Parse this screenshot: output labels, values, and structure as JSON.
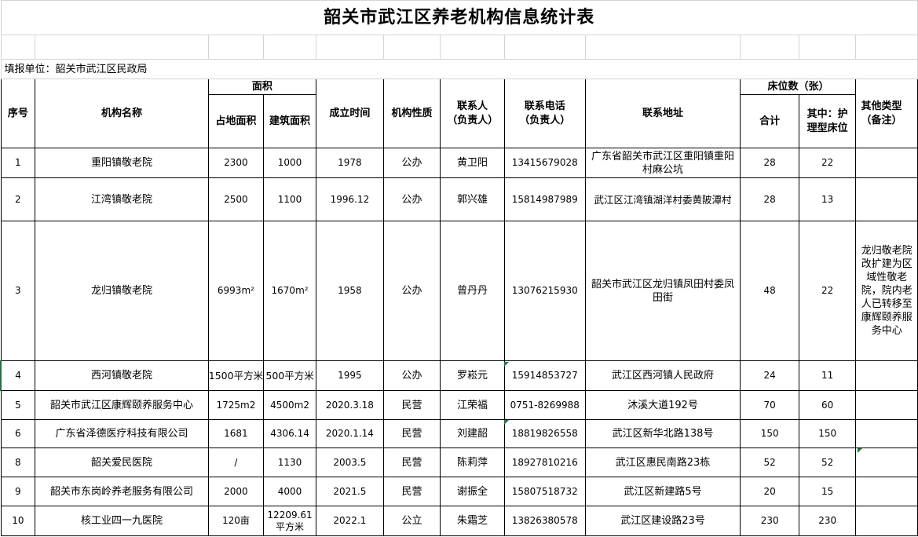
{
  "title": "韶关市武江区养老机构信息统计表",
  "reporting_unit": "填报单位：韶关市武江区民政局",
  "headers": {
    "seq": "序号",
    "name": "机构名称",
    "area_group": "面积",
    "land_area": "占地面积",
    "building_area": "建筑面积",
    "founded": "成立时间",
    "nature": "机构性质",
    "contact": "联系人（负责人）",
    "phone": "联系电话（负责人）",
    "address": "联系地址",
    "beds_group": "床位数（张）",
    "beds_total": "合计",
    "beds_nursing": "其中：护理型床位",
    "other": "其他类型（备注）"
  },
  "rows": [
    {
      "seq": "1",
      "name": "重阳镇敬老院",
      "land": "2300",
      "building": "1000",
      "founded": "1978",
      "nature": "公办",
      "contact": "黄卫阳",
      "phone": "13415679028",
      "address": "广东省韶关市武江区重阳镇重阳村麻公坑",
      "beds": "28",
      "nursing": "22",
      "note": ""
    },
    {
      "seq": "2",
      "name": "江湾镇敬老院",
      "land": "2500",
      "building": "1100",
      "founded": "1996.12",
      "nature": "公办",
      "contact": "郭兴雄",
      "phone": "15814987989",
      "address": "武江区江湾镇湖洋村委黄陂潭村",
      "beds": "28",
      "nursing": "13",
      "note": ""
    },
    {
      "seq": "3",
      "name": "龙归镇敬老院",
      "land": "6993m²",
      "building": "1670m²",
      "founded": "1958",
      "nature": "公办",
      "contact": "曾丹丹",
      "phone": "13076215930",
      "address": "韶关市武江区龙归镇凤田村委凤田街",
      "beds": "48",
      "nursing": "22",
      "note": "龙归敬老院改扩建为区域性敬老院，院内老人已转移至康辉颐养服务中心"
    },
    {
      "seq": "4",
      "name": "西河镇敬老院",
      "land": "1500平方米",
      "building": "500平方米",
      "founded": "1995",
      "nature": "公办",
      "contact": "罗崧元",
      "phone": "15914853727",
      "address": "武江区西河镇人民政府",
      "beds": "24",
      "nursing": "11",
      "note": ""
    },
    {
      "seq": "5",
      "name": "韶关市武江区康辉颐养服务中心",
      "land": "1725m2",
      "building": "4500m2",
      "founded": "2020.3.18",
      "nature": "民营",
      "contact": "江荣福",
      "phone": "0751-8269988",
      "address": "沐溪大道192号",
      "beds": "70",
      "nursing": "60",
      "note": ""
    },
    {
      "seq": "6",
      "name": "广东省泽德医疗科技有限公司",
      "land": "1681",
      "building": "4306.14",
      "founded": "2020.1.14",
      "nature": "民营",
      "contact": "刘建韶",
      "phone": "18819826558",
      "address": "武江区新华北路138号",
      "beds": "150",
      "nursing": "150",
      "note": ""
    },
    {
      "seq": "8",
      "name": "韶关爱民医院",
      "land": "/",
      "building": "1130",
      "founded": "2003.5",
      "nature": "民营",
      "contact": "陈莉萍",
      "phone": "18927810216",
      "address": "武江区惠民南路23栋",
      "beds": "52",
      "nursing": "52",
      "note": ""
    },
    {
      "seq": "9",
      "name": "韶关市东岗岭养老服务有限公司",
      "land": "2000",
      "building": "4000",
      "founded": "2021.5",
      "nature": "民营",
      "contact": "谢振全",
      "phone": "15807518732",
      "address": "武江区新建路5号",
      "beds": "20",
      "nursing": "15",
      "note": ""
    },
    {
      "seq": "10",
      "name": "核工业四一九医院",
      "land": "120亩",
      "building": "12209.61平方米",
      "founded": "2022.1",
      "nature": "公立",
      "contact": "朱霜芝",
      "phone": "13826380578",
      "address": "武江区建设路23号",
      "beds": "230",
      "nursing": "230",
      "note": ""
    }
  ]
}
